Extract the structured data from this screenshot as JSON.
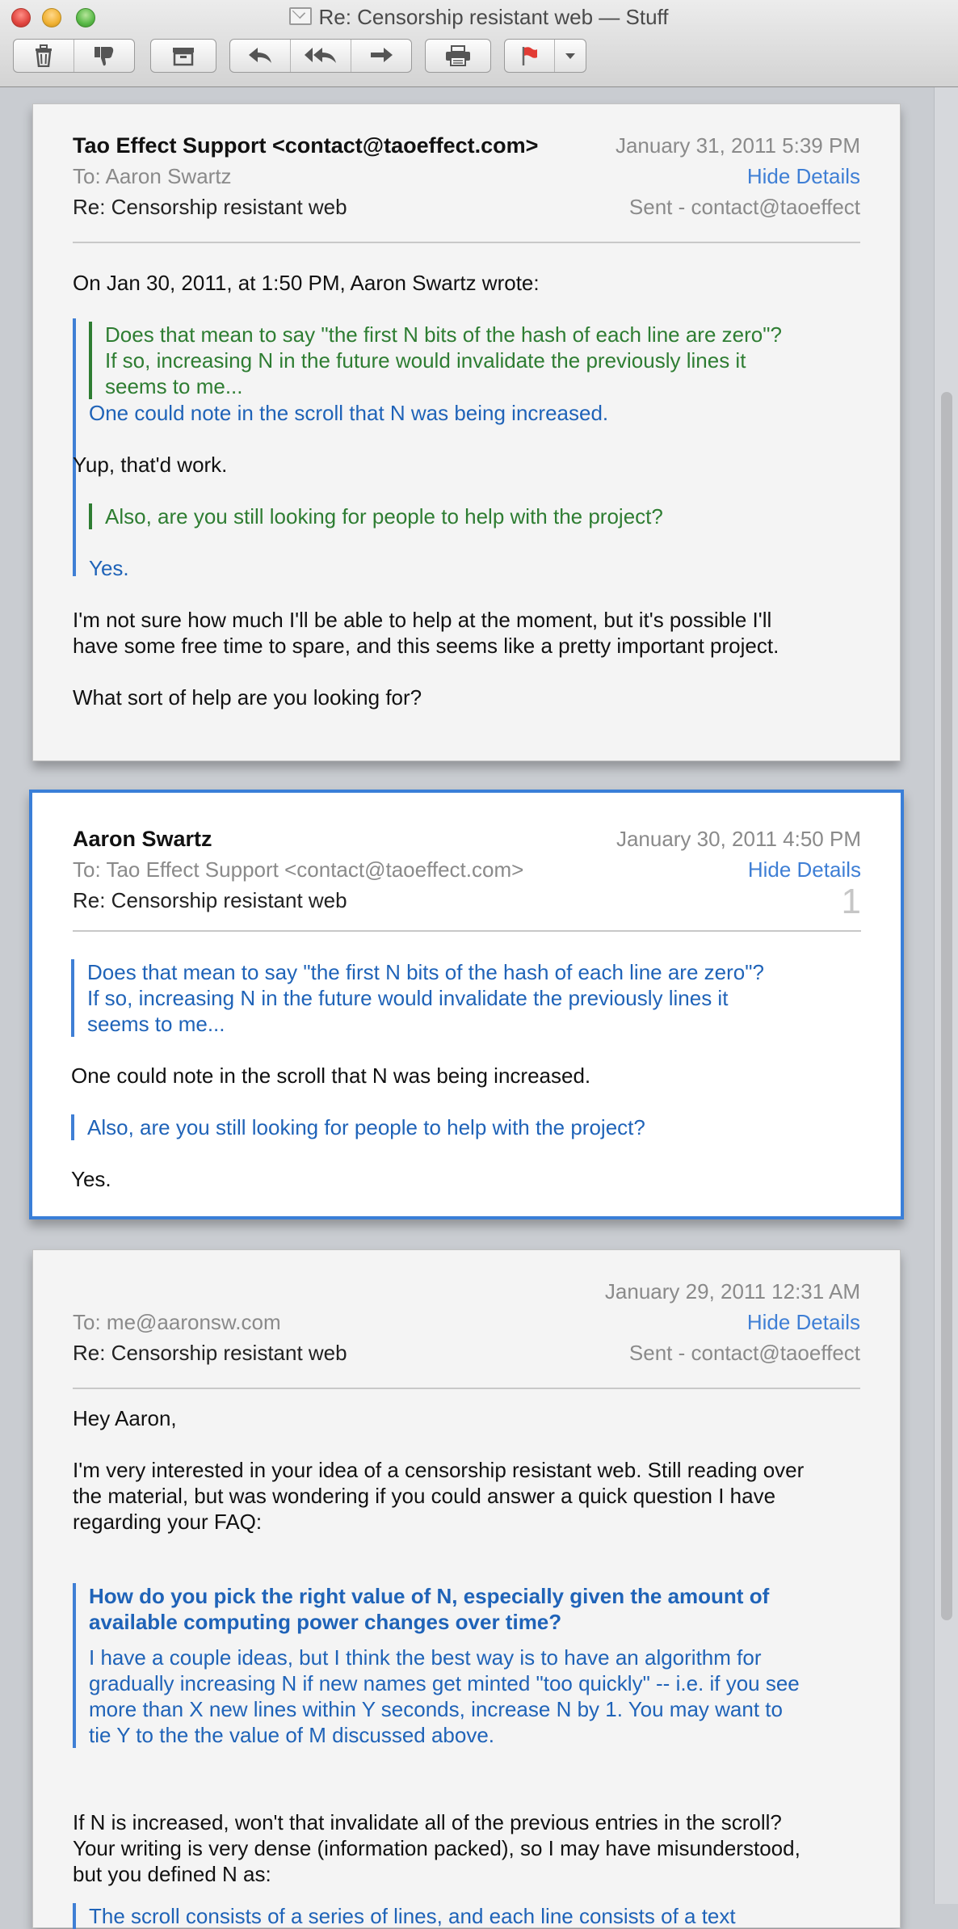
{
  "window": {
    "title": "Re: Censorship resistant web — Stuff"
  },
  "toolbar": {
    "icons": [
      "trash-icon",
      "junk-icon",
      "archive-icon",
      "reply-icon",
      "reply-all-icon",
      "forward-icon",
      "print-icon",
      "flag-icon",
      "dropdown-arrow-icon"
    ]
  },
  "messages": [
    {
      "from": "Tao Effect Support <contact@taoeffect.com>",
      "to": "To:  Aaron Swartz",
      "subject": "Re: Censorship resistant web",
      "date": "January 31, 2011  5:39 PM",
      "hide_details": "Hide Details",
      "sent": "Sent - contact@taoeffect",
      "body": {
        "intro": "On Jan 30, 2011, at 1:50 PM, Aaron Swartz wrote:",
        "nested_quote_1": [
          "Does that mean to say \"the first N bits of the hash of each line are zero\"?",
          "If so, increasing N in the future would invalidate the previously lines it",
          "seems to me..."
        ],
        "quote_reply_1": "One could note in the scroll that N was being increased.",
        "reply_1": "Yup, that'd work.",
        "nested_quote_2": "Also, are you still looking for people to help with the project?",
        "quote_reply_2": "Yes.",
        "para_1": [
          "I'm not sure how much I'll be able to help at the moment, but it's possible I'll",
          "have some free time to spare, and this seems like a pretty important project."
        ],
        "para_2": "What sort of help are you looking for?"
      }
    },
    {
      "from": "Aaron Swartz",
      "to": "To:  Tao Effect Support <contact@taoeffect.com>",
      "subject": "Re: Censorship resistant web",
      "date": "January 30, 2011  4:50 PM",
      "hide_details": "Hide Details",
      "count": "1",
      "body": {
        "quote_1": [
          "Does that mean to say \"the first N bits of the hash of each line are zero\"?",
          "If so, increasing N in the future would invalidate the previously lines it",
          "seems to me..."
        ],
        "reply_1": "One could note in the scroll that N was being increased.",
        "quote_2": "Also, are you still looking for people to help with the project?",
        "reply_2": "Yes."
      }
    },
    {
      "from": "",
      "to": "To:  me@aaronsw.com",
      "subject": "Re: Censorship resistant web",
      "date": "January 29, 2011  12:31 AM",
      "hide_details": "Hide Details",
      "sent": "Sent - contact@taoeffect",
      "body": {
        "greeting": "Hey Aaron,",
        "para_1": [
          "I'm very interested in your idea of a censorship resistant web. Still reading over",
          "the material, but was wondering if you could answer a quick question I have",
          "regarding your FAQ:"
        ],
        "quote_heading": [
          "How do you pick the right value of N, especially given the amount of",
          "available computing power changes over time?"
        ],
        "quote_text": [
          "I have a couple ideas, but I think the best way is to have an algorithm for",
          "gradually increasing N if new names get minted \"too quickly\" -- i.e. if you see",
          "more than X new lines within Y seconds, increase N by 1. You may want to",
          "tie Y to the the value of M discussed above."
        ],
        "para_2": [
          "If N is increased, won't that invalidate all of the previous entries in the scroll?",
          "Your writing is very dense (information packed), so I may have misunderstood,",
          "but you defined N as:"
        ],
        "cut_quote": "The scroll consists of a series of lines, and each line consists of a text"
      }
    }
  ]
}
